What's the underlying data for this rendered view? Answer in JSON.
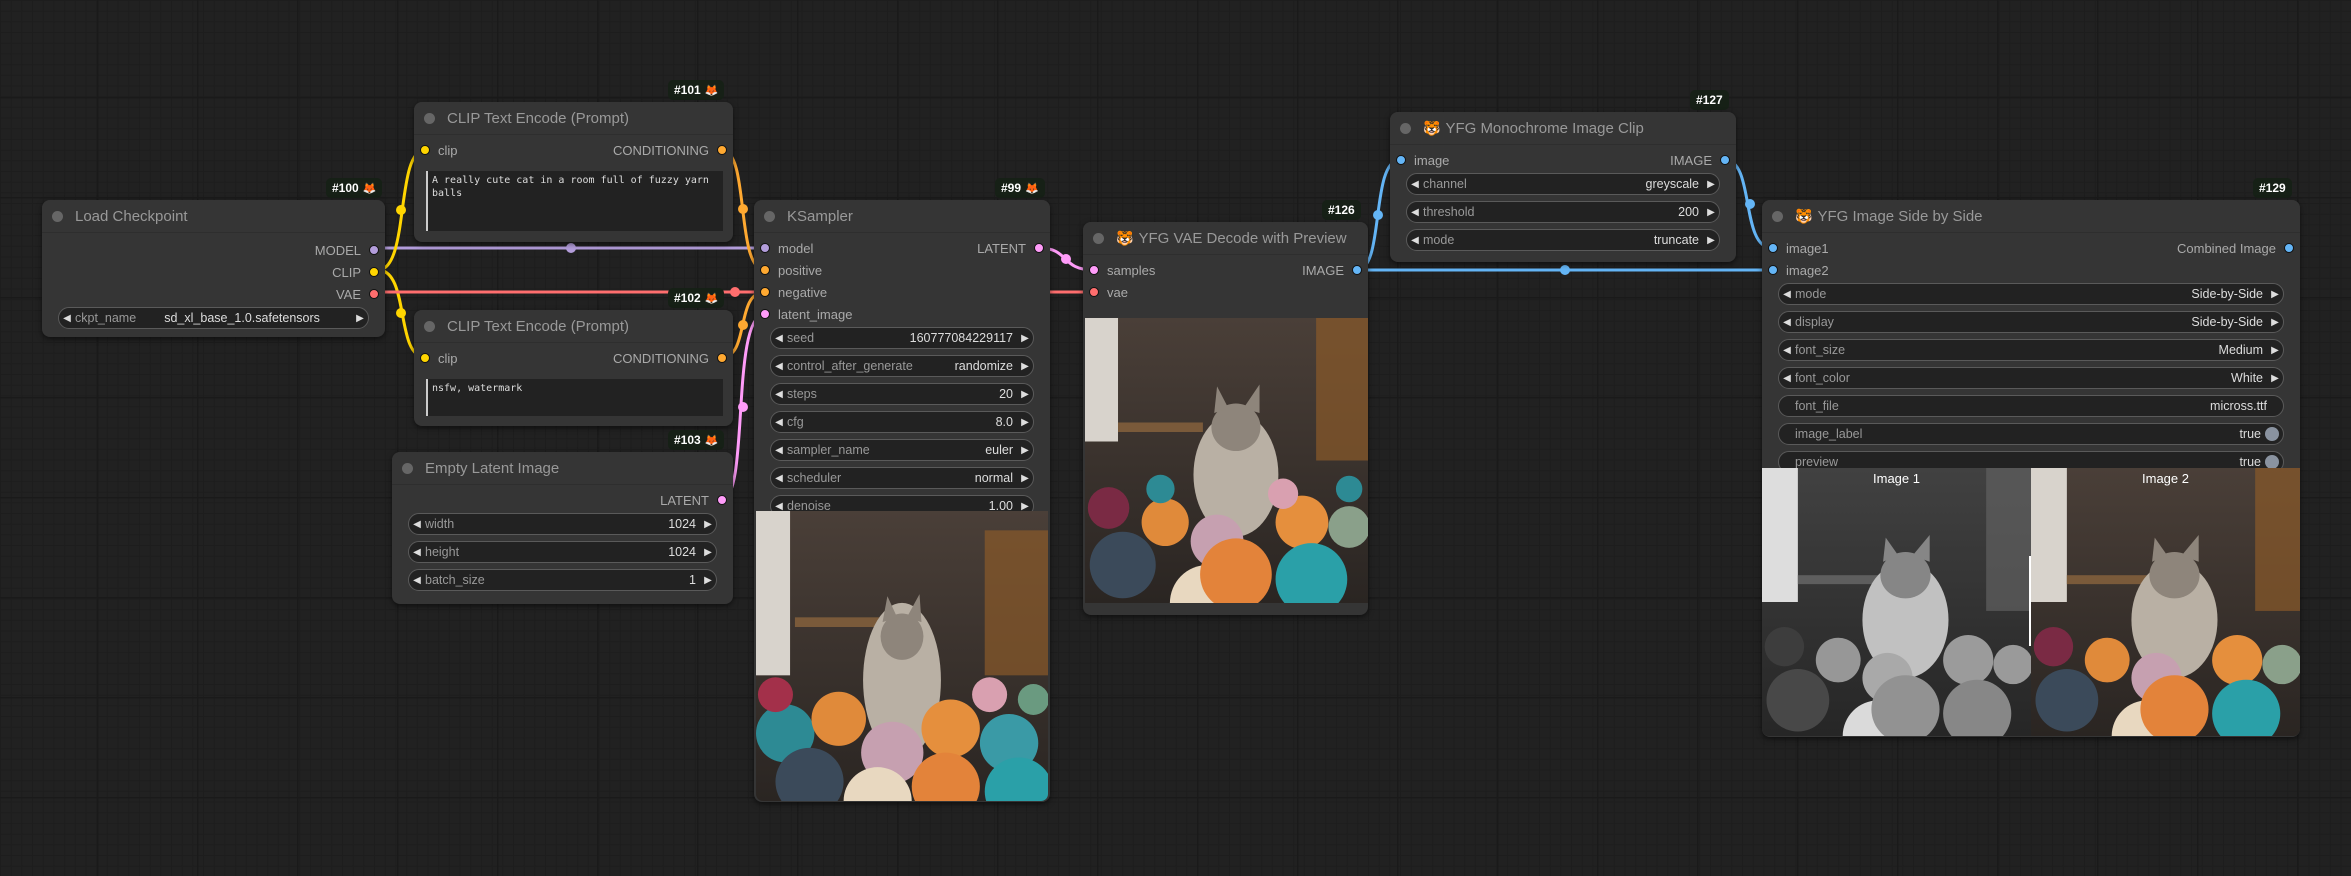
{
  "link_colors": {
    "model": "#b39ddb",
    "clip": "#ffd500",
    "vae": "#ff6e6e",
    "conditioning": "#ffa931",
    "latent": "#ff9cf9",
    "image": "#64b5f6"
  },
  "nodes": {
    "load_checkpoint": {
      "id": "#100",
      "title": "Load Checkpoint",
      "outputs": [
        "MODEL",
        "CLIP",
        "VAE"
      ],
      "widgets": [
        {
          "label": "ckpt_name",
          "value": "sd_xl_base_1.0.safetensors"
        }
      ]
    },
    "clip_positive": {
      "id": "#101",
      "title": "CLIP Text Encode (Prompt)",
      "input": "clip",
      "output": "CONDITIONING",
      "text": "A really cute cat in a room full of fuzzy yarn balls"
    },
    "clip_negative": {
      "id": "#102",
      "title": "CLIP Text Encode (Prompt)",
      "input": "clip",
      "output": "CONDITIONING",
      "text": "nsfw, watermark"
    },
    "empty_latent": {
      "id": "#103",
      "title": "Empty Latent Image",
      "output": "LATENT",
      "widgets": [
        {
          "label": "width",
          "value": "1024"
        },
        {
          "label": "height",
          "value": "1024"
        },
        {
          "label": "batch_size",
          "value": "1"
        }
      ]
    },
    "ksampler": {
      "id": "#99",
      "title": "KSampler",
      "inputs": [
        "model",
        "positive",
        "negative",
        "latent_image"
      ],
      "output": "LATENT",
      "widgets": [
        {
          "label": "seed",
          "value": "160777084229117"
        },
        {
          "label": "control_after_generate",
          "value": "randomize"
        },
        {
          "label": "steps",
          "value": "20"
        },
        {
          "label": "cfg",
          "value": "8.0"
        },
        {
          "label": "sampler_name",
          "value": "euler"
        },
        {
          "label": "scheduler",
          "value": "normal"
        },
        {
          "label": "denoise",
          "value": "1.00"
        }
      ]
    },
    "vae_decode": {
      "id": "#126",
      "title": "YFG VAE Decode with Preview",
      "inputs": [
        "samples",
        "vae"
      ],
      "output": "IMAGE"
    },
    "monochrome": {
      "id": "#127",
      "title": "YFG Monochrome Image Clip",
      "input": "image",
      "output": "IMAGE",
      "widgets": [
        {
          "label": "channel",
          "value": "greyscale"
        },
        {
          "label": "threshold",
          "value": "200"
        },
        {
          "label": "mode",
          "value": "truncate"
        }
      ]
    },
    "side_by_side": {
      "id": "#129",
      "title": "YFG Image Side by Side",
      "inputs": [
        "image1",
        "image2"
      ],
      "output": "Combined Image",
      "widgets": [
        {
          "label": "mode",
          "value": "Side-by-Side"
        },
        {
          "label": "display",
          "value": "Side-by-Side"
        },
        {
          "label": "font_size",
          "value": "Medium"
        },
        {
          "label": "font_color",
          "value": "White"
        }
      ],
      "text_widgets": [
        {
          "label": "font_file",
          "value": "micross.ttf"
        }
      ],
      "toggles": [
        {
          "label": "image_label",
          "value": "true"
        },
        {
          "label": "preview",
          "value": "true"
        }
      ],
      "preview_labels": [
        "Image 1",
        "Image 2"
      ]
    }
  },
  "icons": {
    "fox": "🦊",
    "tiger": "🐯",
    "arrow_left": "◀",
    "arrow_right": "▶"
  }
}
